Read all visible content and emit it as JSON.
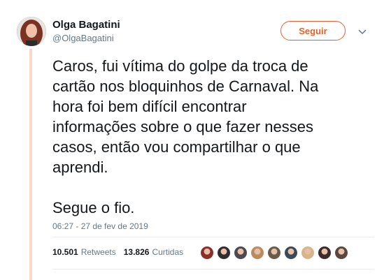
{
  "author": {
    "name": "Olga Bagatini",
    "handle": "@OlgaBagatini"
  },
  "follow_label": "Seguir",
  "tweet": {
    "text": "Caros, fui vítima do golpe da troca de\ncartão nos bloquinhos de Carnaval. Na\nhora foi bem difícil encontrar\ninformações sobre o que fazer nesses\ncasos, então vou compartilhar o que\naprendi.\n\nSegue o fio.",
    "timestamp": "06:27 - 27 de fev de 2019"
  },
  "stats": {
    "retweets_count": "10.501",
    "retweets_label": "Retweets",
    "likes_count": "13.826",
    "likes_label": "Curtidas"
  },
  "liker_avatar_colors": [
    "#8a2f2a",
    "#2d2d33",
    "#4a4a50",
    "#b98b5e",
    "#6b5a49",
    "#3b4a5a",
    "#d9b48a",
    "#3a2a2a",
    "#5b4640"
  ],
  "colors": {
    "accent": "#e0612b",
    "thread_line": "#f7d9c9",
    "muted": "#657786"
  }
}
